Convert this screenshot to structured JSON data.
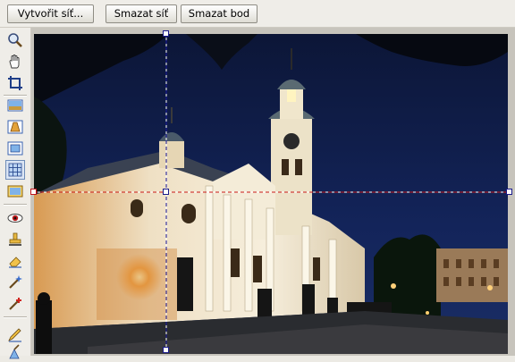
{
  "toolbar": {
    "create_mesh": "Vytvořit síť...",
    "delete_mesh": "Smazat síť",
    "delete_point": "Smazat bod"
  },
  "tools": [
    {
      "icon": "zoom-icon"
    },
    {
      "icon": "hand-pan-icon"
    },
    {
      "icon": "crop-icon"
    },
    {
      "icon": "straighten-icon"
    },
    {
      "icon": "perspective-icon"
    },
    {
      "icon": "resize-icon"
    },
    {
      "icon": "mesh-warp-icon",
      "selected": true
    },
    {
      "icon": "canvas-icon"
    },
    {
      "icon": "red-eye-icon"
    },
    {
      "icon": "clone-stamp-icon"
    },
    {
      "icon": "eraser-icon"
    },
    {
      "icon": "magic-brush-icon"
    },
    {
      "icon": "healing-brush-icon"
    },
    {
      "icon": "pencil-icon"
    },
    {
      "icon": "retouch-icon"
    }
  ],
  "colors": {
    "vertical_line": "#1a1aa0",
    "horizontal_line": "#cc1b1b",
    "sky": "#0f1b3e"
  }
}
